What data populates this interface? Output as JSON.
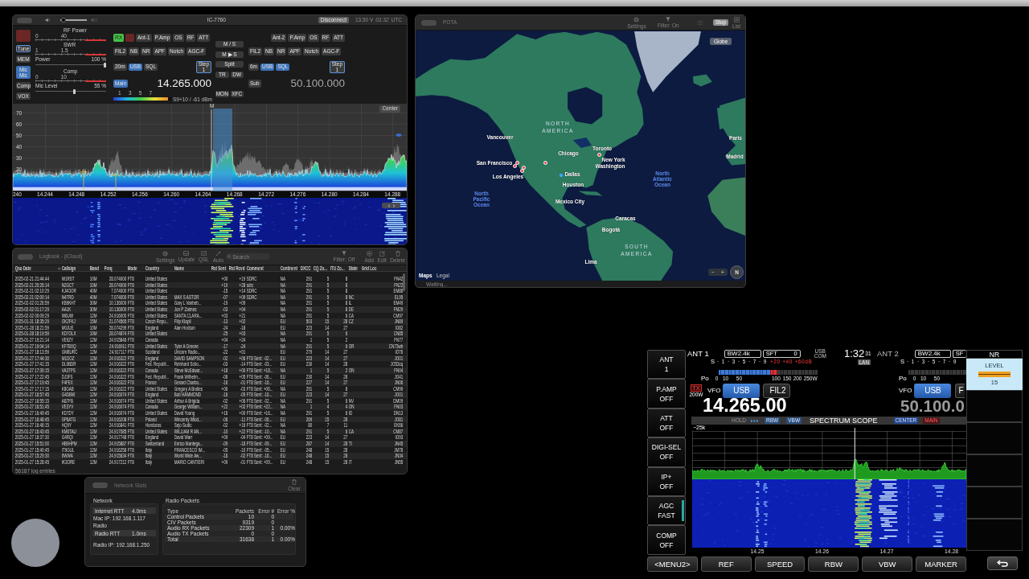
{
  "radio_window": {
    "title": "IC-7760",
    "volume": {
      "level": 0.05
    },
    "disconnect": "Disconnect",
    "voltage": "13.50 V",
    "time": "01:32",
    "timezone": "UTC",
    "side_buttons": [
      {
        "kind": "tx",
        "on": false,
        "focused": false
      },
      {
        "kind": "toggle",
        "label": "Tune",
        "on": false,
        "focused": true
      },
      {
        "kind": "toggle",
        "label": "MEM",
        "on": false,
        "focused": false
      },
      {
        "kind": "toggle",
        "label": "Mic\nMic",
        "on": true,
        "focused": false
      },
      {
        "kind": "toggle",
        "label": "Comp",
        "on": false,
        "focused": false
      },
      {
        "kind": "toggle",
        "label": "VOX",
        "on": false,
        "focused": false
      }
    ],
    "meters": [
      {
        "kind": "scale",
        "label": "RF Power",
        "ticks": [
          "0",
          "40"
        ]
      },
      {
        "kind": "scale",
        "label": "SWR",
        "ticks": [
          "1",
          "1.5"
        ]
      },
      {
        "kind": "slider",
        "label": "Power",
        "value": "100 %",
        "level": 1
      },
      {
        "kind": "scale",
        "label": "Comp",
        "ticks": [
          "0",
          "10"
        ]
      },
      {
        "kind": "slider",
        "label": "Mic Level",
        "value": "55 %",
        "level": 0.55
      }
    ],
    "main": {
      "controls": [
        {
          "kind": "rx",
          "label": "RX",
          "on": true
        },
        {
          "kind": "tx",
          "on": false
        },
        {
          "kind": "toggle",
          "label": "Ant-1",
          "on": false
        },
        {
          "kind": "toggle",
          "label": "P.Amp",
          "on": false
        },
        {
          "kind": "toggle",
          "label": "OS",
          "on": false
        },
        {
          "kind": "toggle",
          "label": "RF",
          "on": false
        },
        {
          "kind": "toggle",
          "label": "ATT",
          "on": false
        }
      ],
      "filters": [
        {
          "kind": "toggle",
          "label": "FIL2",
          "on": false
        },
        {
          "kind": "toggle",
          "label": "NB",
          "on": false
        },
        {
          "kind": "toggle",
          "label": "NR",
          "on": false
        },
        {
          "kind": "toggle",
          "label": "APF",
          "on": false
        },
        {
          "kind": "toggle",
          "label": "Notch",
          "on": false
        },
        {
          "kind": "toggle",
          "label": "AGC-F",
          "on": false
        }
      ],
      "modes": [
        {
          "kind": "toggle",
          "label": "20m",
          "on": false
        },
        {
          "kind": "toggle",
          "label": "USB",
          "on": true
        },
        {
          "kind": "toggle",
          "label": "SQL",
          "on": false
        },
        {
          "kind": "step",
          "label": "Step",
          "value": "1",
          "on": false
        }
      ],
      "vfo_button": {
        "label": "Main",
        "on": true
      },
      "frequency": "14.265.000",
      "active": true,
      "s_meter": {
        "scale": [
          "1",
          "3",
          "5",
          "7"
        ],
        "level": 0.94,
        "reading": "S9+10 / -61 dBm"
      }
    },
    "middle": [
      [
        {
          "label": "M / S",
          "on": false
        }
      ],
      [
        {
          "label": "M ▶ S",
          "on": false
        }
      ],
      [
        {
          "label": "Split",
          "on": false
        }
      ],
      [
        {
          "label": "TR",
          "on": false
        },
        {
          "label": "DW",
          "on": false
        }
      ],
      [
        {
          "label": "MON",
          "on": false
        },
        {
          "label": "XFC",
          "on": false
        }
      ]
    ],
    "sub": {
      "controls": [
        {
          "kind": "toggle",
          "label": "Ant-2",
          "on": false
        },
        {
          "kind": "toggle",
          "label": "P.Amp",
          "on": false
        },
        {
          "kind": "toggle",
          "label": "OS",
          "on": false
        },
        {
          "kind": "toggle",
          "label": "RF",
          "on": false
        },
        {
          "kind": "toggle",
          "label": "ATT",
          "on": false
        }
      ],
      "filters": [
        {
          "kind": "toggle",
          "label": "FIL2",
          "on": false
        },
        {
          "kind": "toggle",
          "label": "NB",
          "on": false
        },
        {
          "kind": "toggle",
          "label": "NR",
          "on": false
        },
        {
          "kind": "toggle",
          "label": "APF",
          "on": false
        },
        {
          "kind": "toggle",
          "label": "Notch",
          "on": false
        },
        {
          "kind": "toggle",
          "label": "AGC-F",
          "on": false
        }
      ],
      "modes": [
        {
          "kind": "toggle",
          "label": "6m",
          "on": false
        },
        {
          "kind": "toggle",
          "label": "USB",
          "on": true
        },
        {
          "kind": "toggle",
          "label": "SQL",
          "on": true
        },
        {
          "kind": "step",
          "label": "Step",
          "value": "1",
          "on": false
        }
      ],
      "vfo_button": {
        "label": "Sub",
        "on": false
      },
      "frequency": "50.100.000",
      "active": false
    },
    "spectrum": {
      "y_labels": [
        "70",
        "60",
        "50",
        "40",
        "30",
        "20"
      ],
      "marker": "M",
      "center_button": "Center",
      "x_labels": [
        "240",
        "14.244",
        "14.248",
        "14.252",
        "14.256",
        "14.260",
        "14.264",
        "14.268",
        "14.272",
        "14.276",
        "14.280",
        "14.284",
        "14.288"
      ]
    }
  },
  "map_window": {
    "title": "POTA",
    "toolbar": [
      "Settings",
      "Filter: On"
    ],
    "stop_button": "Stop",
    "list_label": "List",
    "globe_button": "Globe",
    "labels": [
      {
        "text": "NORTH AMERICA",
        "kind": "region"
      },
      {
        "text": "Vancouver",
        "kind": "city"
      },
      {
        "text": "San Francisco",
        "kind": "city"
      },
      {
        "text": "Los Angeles",
        "kind": "city"
      },
      {
        "text": "Chicago",
        "kind": "city"
      },
      {
        "text": "Toronto",
        "kind": "city"
      },
      {
        "text": "New York",
        "kind": "city"
      },
      {
        "text": "Washington",
        "kind": "city"
      },
      {
        "text": "Dallas",
        "kind": "city"
      },
      {
        "text": "Houston",
        "kind": "city"
      },
      {
        "text": "Mexico City",
        "kind": "city"
      },
      {
        "text": "Caracas",
        "kind": "city"
      },
      {
        "text": "Bogotá",
        "kind": "city"
      },
      {
        "text": "Lima",
        "kind": "city"
      },
      {
        "text": "SOUTH AMERICA",
        "kind": "region"
      },
      {
        "text": "North Pacific Ocean",
        "kind": "ocean"
      },
      {
        "text": "North Atlantic Ocean",
        "kind": "ocean"
      },
      {
        "text": "Paris",
        "kind": "city"
      },
      {
        "text": "Madrid",
        "kind": "city"
      }
    ],
    "zoom_out": "−",
    "zoom_in": "+",
    "compass": "N",
    "maps_logo": "Maps",
    "legal": "Legal",
    "status": "Waiting..."
  },
  "logbook_window": {
    "title": "Logbook - (iCloud)",
    "toolbar": [
      "Settings",
      "Update",
      "QSL",
      "Auto"
    ],
    "search": {
      "placeholder": "Search"
    },
    "toolbar_right": [
      "Filter: Off",
      "Add",
      "Edit",
      "Delete"
    ],
    "columns": [
      {
        "label": "Qso Date",
        "sorted": true
      },
      {
        "label": "Callsign",
        "sorted": false
      },
      {
        "label": "Band",
        "sorted": false
      },
      {
        "label": "Freq",
        "sorted": false
      },
      {
        "label": "Mode",
        "sorted": false
      },
      {
        "label": "Country",
        "sorted": false
      },
      {
        "label": "Name",
        "sorted": false
      },
      {
        "label": "Rst Sent",
        "sorted": false
      },
      {
        "label": "Rst Rcvd",
        "sorted": false
      },
      {
        "label": "Comment",
        "sorted": false
      },
      {
        "label": "Continent",
        "sorted": false
      },
      {
        "label": "DXCC",
        "sorted": false
      },
      {
        "label": "CQ Zo...",
        "sorted": false
      },
      {
        "label": "ITU Zo...",
        "sorted": false
      },
      {
        "label": "State",
        "sorted": false
      },
      {
        "label": "Grid Loc",
        "sorted": false
      }
    ],
    "rows": [
      [
        "2025-02-21 21:44:44",
        "W1RST",
        "10M",
        "28.074000",
        "FT8",
        "United States",
        null,
        "+00",
        "+19",
        "SDRC",
        "NA",
        "291",
        "5",
        "8",
        null,
        "FN42"
      ],
      [
        "2025-02-21 20:26:14",
        "N2GCT",
        "10M",
        "28.074000",
        "FT8",
        "United States",
        null,
        "+10",
        "+28",
        "sdrc",
        "NA",
        "291",
        "5",
        "8",
        null,
        "FN22"
      ],
      [
        "2025-02-21 02:10:29",
        "KJ4OOR",
        "40M",
        "7.074000",
        "FT8",
        "United States",
        null,
        "-15",
        "+14",
        "SDRC",
        "NA",
        "291",
        "5",
        "8",
        null,
        "EM86"
      ],
      [
        "2025-02-21 02:00:14",
        "N4TRD",
        "40M",
        "7.074000",
        "FT8",
        "United States",
        "MAX S ASTOR",
        "-07",
        "+09",
        "SDRC",
        "NA",
        "291",
        "5",
        "8",
        "NC",
        "EL95"
      ],
      [
        "2025-02-02 01:26:59",
        "KB9KHT",
        "30M",
        "10.136000",
        "FT8",
        "United States",
        "Gary L Vanbeb...",
        "-19",
        "+09",
        null,
        "NA",
        "291",
        "5",
        "8",
        "IL",
        "EM49"
      ],
      [
        "2025-02-02 01:17:29",
        "AA1K",
        "30M",
        "10.136000",
        "FT8",
        "United States",
        "Jon P Zaimes",
        "-03",
        "+04",
        null,
        "NA",
        "291",
        "5",
        "8",
        "DE",
        "FM29"
      ],
      [
        "2025-02-02 00:09:29",
        "W6UW",
        "12M",
        "24.916000",
        "FT8",
        "United States",
        "SANTA CLARA...",
        "+03",
        "+21",
        null,
        "NA",
        "291",
        "5",
        "6",
        "CA",
        "CM97"
      ],
      [
        "2025-01-31 18:35:29",
        "OK2FKJ",
        "15M",
        "21.074565",
        "FT8",
        "Czech Repu...",
        "Filip Klapil",
        "-13",
        "+02",
        null,
        "EU",
        "503",
        "15",
        "28",
        "CZ",
        "JN89"
      ],
      [
        "2025-01-28 18:21:59",
        "M0JUE",
        "10M",
        "28.074299",
        "FT8",
        "England",
        "Alan Hodson",
        "-24",
        "-18",
        null,
        "EU",
        "223",
        "14",
        "27",
        null,
        "IO82"
      ],
      [
        "2025-01-28 18:19:59",
        "KD7OLX",
        "10M",
        "28.074874",
        "FT8",
        "United States",
        null,
        "-25",
        "+03",
        null,
        "NA",
        "291",
        "5",
        "6",
        null,
        "CN85"
      ],
      [
        "2025-01-27 19:21:14",
        "VE9ZY",
        "12M",
        "24.915846",
        "FT8",
        "Canada",
        null,
        "+04",
        "+24",
        null,
        "NA",
        "1",
        "5",
        "2",
        null,
        "FN77"
      ],
      [
        "2025-01-27 19:04:14",
        "KF7BXQ",
        "12M",
        "24.916911",
        "FT8",
        "United States",
        "Tyler A Greene",
        "-17",
        "-24",
        null,
        "NA",
        "291",
        "5",
        "6",
        "OR",
        "CN73wb"
      ],
      [
        "2025-01-27 18:13:59",
        "GM8URC",
        "12M",
        "24.917117",
        "FT8",
        "Scotland",
        "Unicorn Radio...",
        "-22",
        "+01",
        null,
        "EU",
        "279",
        "14",
        "27",
        null,
        "IO76"
      ],
      [
        "2025-01-27 17:44:30",
        "M1DOZ",
        "12M",
        "24.916322",
        "FT8",
        "England",
        "DAVID SAMPSON",
        "-02",
        "+06",
        "FT8 Sent: -02...",
        "EU",
        "223",
        "14",
        "27",
        null,
        "JO01"
      ],
      [
        "2025-01-27 17:41:15",
        "DL9BDR",
        "12M",
        "24.916322",
        "FT8",
        "Fed. Republi...",
        "Reinhard Scho...",
        "-03",
        "-14",
        "FT8 Sent: -03...",
        "EU",
        "230",
        "14",
        "28",
        null,
        "JO53cq"
      ],
      [
        "2025-01-27 17:39:15",
        "VA3TPS",
        "12M",
        "24.916322",
        "FT8",
        "Canada",
        "Steve McEdwar...",
        "+18",
        "+00",
        "FT8 Sent: +18...",
        "NA",
        "1",
        "5",
        "2",
        "ON",
        "FN04"
      ],
      [
        "2025-01-27 17:22:45",
        "DJ3FS",
        "12M",
        "24.916322",
        "FT8",
        "Fed. Republi...",
        "Frank Wilhelm...",
        "-06",
        "+05",
        "FT8 Sent: -06...",
        "EU",
        "230",
        "14",
        "28",
        null,
        "JO41"
      ],
      [
        "2025-01-27 17:19:45",
        "F4FEX",
        "12M",
        "24.916322",
        "FT8",
        "France",
        "Gerard Charbo...",
        "-16",
        "-01",
        "FT8 Sent: -16...",
        "EU",
        "227",
        "14",
        "27",
        null,
        "JN06"
      ],
      [
        "2025-01-27 17:17:15",
        "K8GAB",
        "12M",
        "24.916322",
        "FT8",
        "United States",
        "Gregory A Brolles",
        "+06",
        "-03",
        "FT8 Sent: +06...",
        "NA",
        "291",
        "5",
        "8",
        null,
        "CM99"
      ],
      [
        "2025-01-27 16:57:45",
        "G4DBW",
        "12M",
        "24.916074",
        "FT8",
        "England",
        "Bob HAMMOND",
        "-16",
        "-09",
        "FT8 Sent: -16...",
        "EU",
        "223",
        "14",
        "27",
        null,
        "JO01"
      ],
      [
        "2025-01-27 16:55:15",
        "AB7FB",
        "12M",
        "24.916074",
        "FT8",
        "United States",
        "Arthur A Brigida",
        "-02",
        "+06",
        "FT8 Sent: -02...",
        "NA",
        "291",
        "5",
        "6",
        "NV",
        "DM09"
      ],
      [
        "2025-01-27 16:51:45",
        "VE3YV",
        "12M",
        "24.916074",
        "FT8",
        "Canada",
        "George William...",
        "+22",
        "+02",
        "FT8 Sent: +22...",
        "NA",
        "1",
        "4",
        "4",
        "ON",
        "FN03"
      ],
      [
        "2025-01-27 16:49:45",
        "KD7DY",
        "12M",
        "24.916074",
        "FT8",
        "United States",
        "David Young",
        "+16",
        "+00",
        "FT8 Sent: +16...",
        "NA",
        "291",
        "5",
        "6",
        "ID",
        "DN13"
      ],
      [
        "2025-01-27 16:48:45",
        "SP6ATG",
        "12M",
        "24.916208",
        "FT8",
        "Poland",
        "Wincenty Wlod...",
        "-06",
        "-11",
        "FT8 Sent: -06...",
        "EU",
        "269",
        "15",
        "28",
        null,
        "JO81"
      ],
      [
        "2025-01-27 16:46:15",
        "HQ9Y",
        "12M",
        "24.916841",
        "FT8",
        "Honduras",
        "Sejo Sudic",
        "-02",
        "+16",
        "FT8 Sent: -02...",
        "NA",
        "80",
        "7",
        "11",
        null,
        "EK66"
      ],
      [
        "2025-01-27 16:43:45",
        "KM6TAU",
        "12M",
        "24.917085",
        "FT8",
        "United States",
        "WILLIAM R AN...",
        "-10",
        "+22",
        "FT8 Sent: -10...",
        "NA",
        "291",
        "5",
        "6",
        "CA",
        "CM87"
      ],
      [
        "2025-01-27 16:37:30",
        "G4RQI",
        "12M",
        "24.917748",
        "FT8",
        "England",
        "David Warr",
        "+09",
        "-04",
        "FT8 Sent: +09...",
        "EU",
        "223",
        "14",
        "27",
        null,
        "IO93"
      ],
      [
        "2025-01-27 15:51:00",
        "HB9HPM",
        "12M",
        "24.915887",
        "FT8",
        "Switzerland",
        "Enrico Mantega...",
        "-09",
        "-18",
        "FT8 Sent: -09...",
        "EU",
        "287",
        "14",
        "28",
        "TI",
        "JN45"
      ],
      [
        "2025-01-27 15:40:45",
        "IT9GUL",
        "12M",
        "24.916258",
        "FT8",
        "Italy",
        "FRANCESCO IM...",
        "-05",
        "-10",
        "FT8 Sent: -05...",
        "EU",
        "248",
        "15",
        "28",
        null,
        "JM78"
      ],
      [
        "2025-01-27 15:29:30",
        "IIWWA",
        "12M",
        "24.915634",
        "FT8",
        "Italy",
        "World Wide Aw...",
        "-16",
        "-02",
        "FT8 Sent: -16...",
        "EU",
        "248",
        "15",
        "28",
        null,
        "JN34"
      ],
      [
        "2025-01-27 15:28:45",
        "IK3ORE",
        "12M",
        "24.917212",
        "FT8",
        "Italy",
        "MARIO CANTIERI",
        "+09",
        "-01",
        "FT8 Sent: +09...",
        "EU",
        "248",
        "15",
        "28",
        "IT",
        "JN55"
      ]
    ],
    "footer": "56187 log entries"
  },
  "network_window": {
    "title": "Network Stats",
    "clear": "Clear",
    "network": {
      "heading": "Network",
      "rows": [
        {
          "label": "Internet RTT",
          "value": "4.0ms"
        }
      ],
      "ip": "Mac IP: 192.168.1.117"
    },
    "radio": {
      "heading": "Radio",
      "rows": [
        {
          "label": "Radio RTT",
          "value": "1.0ms"
        }
      ],
      "ip": "Radio IP: 192.168.1.250"
    },
    "packets": {
      "heading": "Radio Packets",
      "columns": [
        "Type",
        "Packets",
        "Error #",
        "Error %"
      ],
      "rows": [
        [
          "Control Packets",
          "10",
          "0"
        ],
        [
          "CIV Packets",
          "9319",
          "0"
        ],
        [
          "Audio RX Packets",
          "22309",
          "1",
          "0.00%"
        ],
        [
          "Audio TX Packets",
          "0",
          "0"
        ],
        [
          "Total",
          "31638",
          "1",
          "0.00%"
        ]
      ]
    }
  },
  "transceiver_screen": {
    "side_keys": [
      {
        "label": "ANT",
        "value": "1",
        "active": false
      },
      {
        "label": "P.AMP",
        "value": "OFF",
        "active": false
      },
      {
        "label": "ATT",
        "value": "OFF",
        "active": false
      },
      {
        "label": "DIGI-SEL",
        "value": "OFF",
        "active": false
      },
      {
        "label": "IP+",
        "value": "OFF",
        "active": false
      },
      {
        "label": "AGC",
        "value": "FAST",
        "active": true
      },
      {
        "label": "COMP",
        "value": "OFF",
        "active": false
      }
    ],
    "main": {
      "antenna": "ANT 1",
      "bandwidth": "BW2.4k",
      "shift": {
        "label": "SFT",
        "value": "0"
      },
      "s_label": "S",
      "s_scale": "·1·3·5·7·9",
      "s_over": "+20 +40 +60dB",
      "level": 0.59,
      "po_label": "Po",
      "po_scale": [
        "0",
        "10",
        "50",
        "100",
        "150",
        "200",
        "250W"
      ],
      "tx": "TX",
      "power": "200W",
      "vfo": "VFO",
      "mode": "USB",
      "filter": "FIL2",
      "frequency": "14.265.00"
    },
    "connection": "USB COM",
    "clock": {
      "time": "1:32",
      "seconds": "31"
    },
    "network": "LAN",
    "sub": {
      "antenna": "ANT 2",
      "bandwidth": "BW2.4k",
      "shift": {
        "label": "SF"
      },
      "s_label": "S",
      "s_scale": "·1·3·5·7·9",
      "po_label": "Po",
      "po_scale": [
        "0",
        "10",
        "50"
      ],
      "vfo": "VFO",
      "mode": "USB",
      "filter": "F",
      "frequency": "50.100.0"
    },
    "scope_bar": {
      "hold": "HOLD",
      "rbw": "RBW",
      "vbw": "VBW",
      "title": "SPECTRUM SCOPE",
      "center": "CENTER",
      "main": "MAIN"
    },
    "span": "−25k",
    "axis": [
      "14.25",
      "14.26",
      "14.27",
      "14.28"
    ],
    "menu_keys": [
      "<MENU2>",
      "REF",
      "SPEED",
      "RBW",
      "VBW",
      "MARKER"
    ],
    "nr": {
      "title": "NR",
      "label": "LEVEL",
      "value": "15"
    }
  }
}
